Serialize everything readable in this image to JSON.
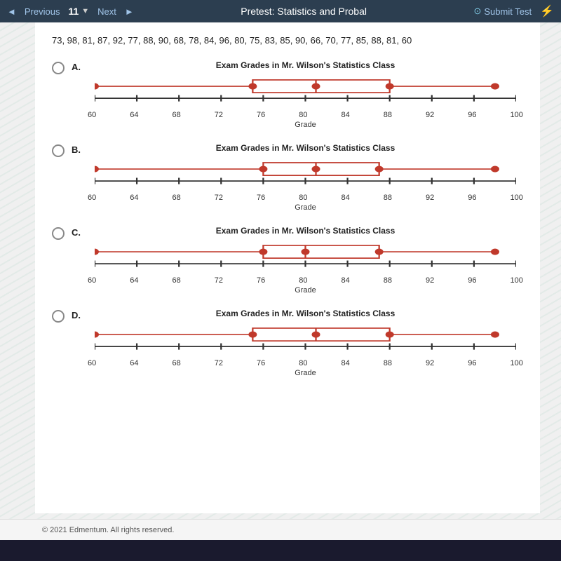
{
  "nav": {
    "prev_label": "Previous",
    "question_num": "11",
    "next_label": "Next",
    "title": "Pretest: Statistics and Probal",
    "submit_label": "Submit Test"
  },
  "question": {
    "data_line": "73, 98, 81, 87, 92, 77, 88, 90, 68, 78, 84, 96, 80, 75, 83, 85, 90, 66, 70, 77, 85, 88, 81, 60"
  },
  "options": [
    {
      "label": "A.",
      "chart_title": "Exam Grades in Mr. Wilson's Statistics Class"
    },
    {
      "label": "B.",
      "chart_title": "Exam Grades in Mr. Wilson's Statistics Class"
    },
    {
      "label": "C.",
      "chart_title": "Exam Grades in Mr. Wilson's Statistics Class"
    },
    {
      "label": "D.",
      "chart_title": "Exam Grades in Mr. Wilson's Statistics Class"
    }
  ],
  "axis": {
    "labels": [
      "60",
      "64",
      "68",
      "72",
      "76",
      "80",
      "84",
      "88",
      "92",
      "96",
      "100"
    ],
    "axis_label": "Grade"
  },
  "boxplots": {
    "A": {
      "min": 60,
      "q1": 75,
      "median": 81,
      "q3": 88,
      "max": 98
    },
    "B": {
      "min": 60,
      "q1": 76,
      "median": 81,
      "q3": 87,
      "max": 98
    },
    "C": {
      "min": 60,
      "q1": 76,
      "median": 81,
      "q3": 87,
      "max": 98
    },
    "D": {
      "min": 60,
      "q1": 75,
      "median": 81,
      "q3": 88,
      "max": 98
    }
  },
  "footer": {
    "copyright": "© 2021 Edmentum. All rights reserved."
  }
}
